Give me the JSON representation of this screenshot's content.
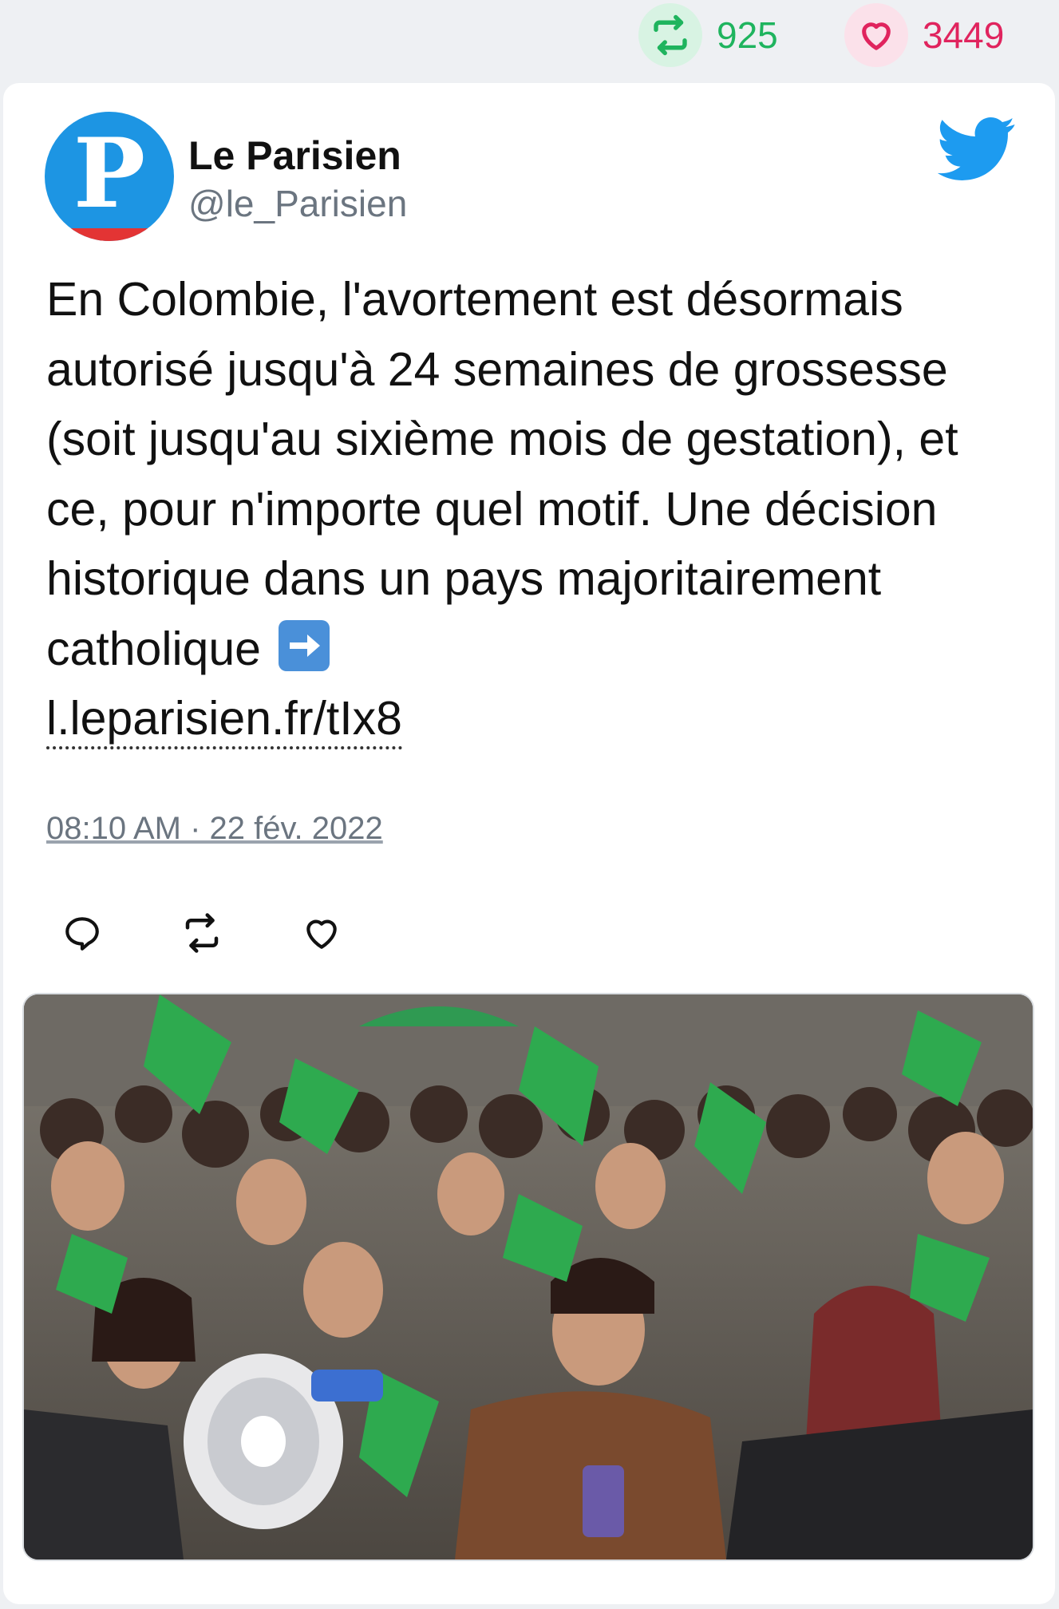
{
  "stats": {
    "retweet_count": "925",
    "like_count": "3449",
    "retweet_icon": "retweet-icon",
    "like_icon": "heart-icon"
  },
  "tweet": {
    "author_name": "Le Parisien",
    "author_handle": "@le_Parisien",
    "avatar_letter": "P",
    "text": "En Colombie, l'avortement est désormais autorisé jusqu'à 24 semaines de grossesse (soit jusqu'au sixième mois de gestation), et ce, pour n'importe quel motif. Une décision historique dans un pays majoritairement catholique",
    "emoji": "right-arrow-emoji",
    "link": "l.leparisien.fr/tIx8",
    "timestamp": "08:10 AM · 22 fév. 2022"
  },
  "actions": [
    {
      "name": "reply",
      "icon": "reply-icon"
    },
    {
      "name": "retweet",
      "icon": "retweet-icon"
    },
    {
      "name": "like",
      "icon": "heart-icon"
    }
  ],
  "colors": {
    "twitter_blue": "#1d9bf0",
    "retweet_green": "#1fb45e",
    "like_pink": "#e0245e",
    "background": "#eef0f3",
    "card": "#ffffff"
  },
  "media": {
    "type": "photo"
  }
}
